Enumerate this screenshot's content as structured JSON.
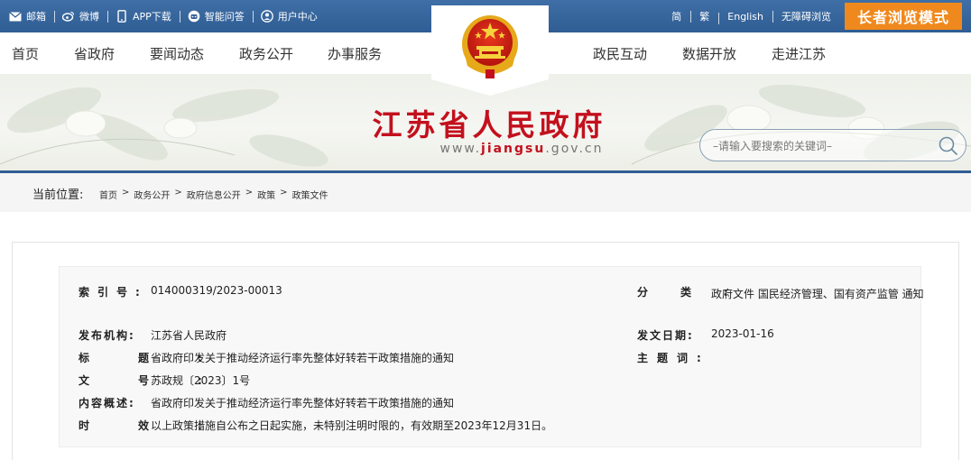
{
  "topbar": {
    "left_links": [
      {
        "label": "邮箱",
        "icon": "mail-icon"
      },
      {
        "label": "微博",
        "icon": "weibo-icon"
      },
      {
        "label": "APP下载",
        "icon": "phone-icon"
      },
      {
        "label": "智能问答",
        "icon": "robot-icon"
      },
      {
        "label": "用户中心",
        "icon": "user-icon"
      }
    ],
    "right_links": [
      "简",
      "繁",
      "English",
      "无障碍浏览"
    ],
    "elder_mode": "长者浏览模式"
  },
  "nav": {
    "items": [
      "首页",
      "省政府",
      "要闻动态",
      "政务公开",
      "办事服务",
      "政民互动",
      "数据开放",
      "走进江苏"
    ]
  },
  "banner": {
    "title": "江苏省人民政府",
    "url_prefix": "www.",
    "url_bold": "jiangsu",
    "url_suffix": ".gov.cn"
  },
  "search": {
    "placeholder": "–请输入要搜索的关键词–"
  },
  "breadcrumb": {
    "label": "当前位置:",
    "items": [
      "首页",
      "政务公开",
      "政府信息公开",
      "政策",
      "政策文件"
    ],
    "separator": ">"
  },
  "doc_info": {
    "index_label": "索引号:",
    "index_value": "014000319/2023-00013",
    "category_label": "分类:",
    "category_value": "政府文件 国民经济管理、国有资产监管 通知",
    "issuer_label": "发布机构:",
    "issuer_value": "江苏省人民政府",
    "date_label": "发文日期:",
    "date_value": "2023-01-16",
    "title_label": "标题:",
    "title_value": "省政府印发关于推动经济运行率先整体好转若干政策措施的通知",
    "keywords_label": "主题词:",
    "keywords_value": "",
    "docno_label": "文号:",
    "docno_value": "苏政规〔2023〕1号",
    "summary_label": "内容概述:",
    "summary_value": "省政府印发关于推动经济运行率先整体好转若干政策措施的通知",
    "validity_label": "时效:",
    "validity_value": "以上政策措施自公布之日起实施，未特别注明时限的，有效期至2023年12月31日。"
  },
  "colors": {
    "topbar": "#2f5d94",
    "elder_button": "#f0891d",
    "title_red": "#c3101d"
  }
}
